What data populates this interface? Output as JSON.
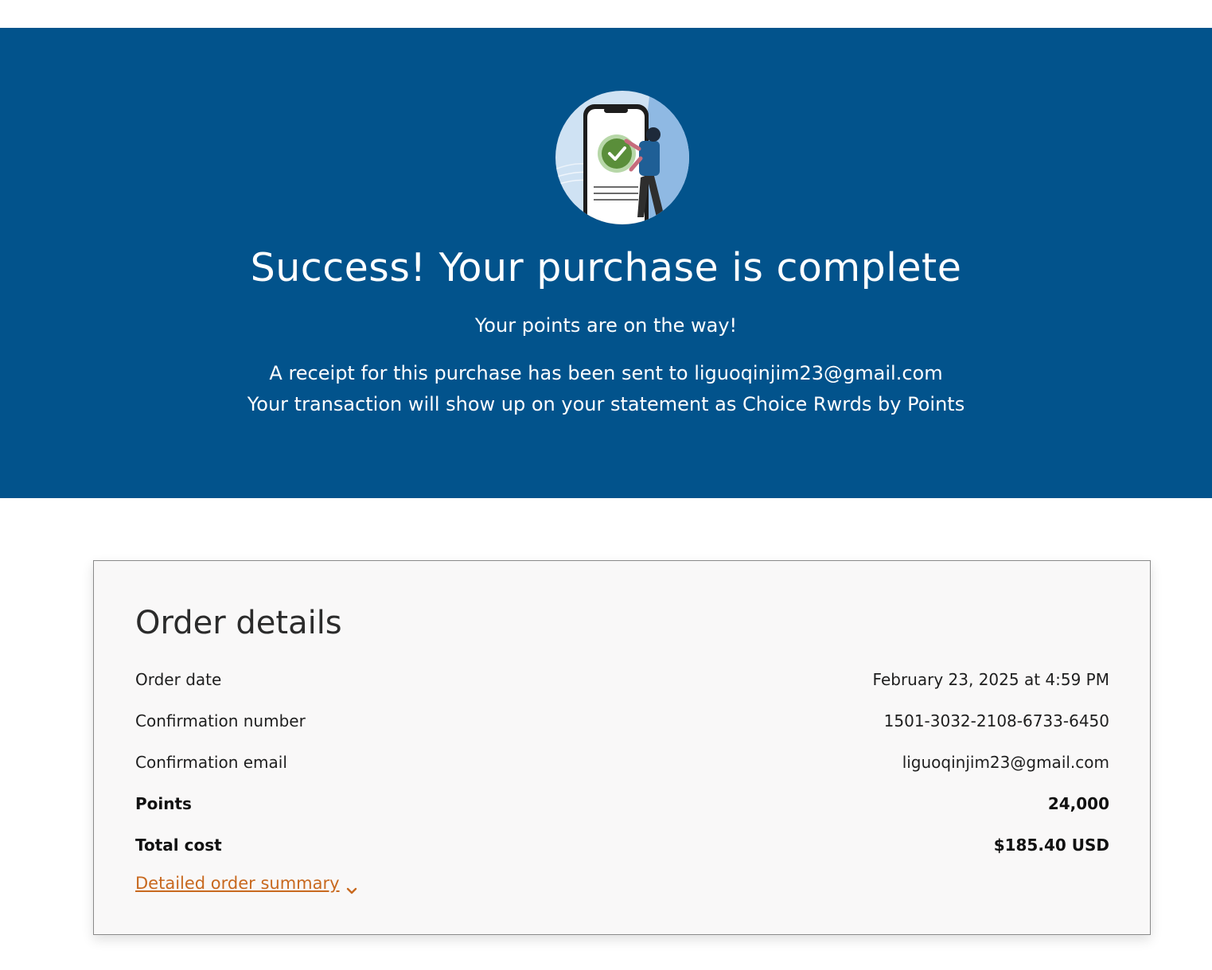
{
  "hero": {
    "title": "Success! Your purchase is complete",
    "subtitle": "Your points are on the way!",
    "receipt_line": "A receipt for this purchase has been sent to liguoqinjim23@gmail.com",
    "statement_line": "Your transaction will show up on your statement as Choice Rwrds by Points",
    "illustration_icon": "phone-checkmark-illustration",
    "background_color": "#02538c"
  },
  "order": {
    "title": "Order details",
    "rows": [
      {
        "label": "Order date",
        "value": "February 23, 2025 at 4:59 PM"
      },
      {
        "label": "Confirmation number",
        "value": "1501-3032-2108-6733-6450"
      },
      {
        "label": "Confirmation email",
        "value": "liguoqinjim23@gmail.com"
      },
      {
        "label": "Points",
        "value": "24,000"
      },
      {
        "label": "Total cost",
        "value": "$185.40 USD"
      }
    ],
    "summary_link": "Detailed order summary",
    "summary_icon": "chevron-down-icon",
    "link_color": "#c8691f"
  }
}
